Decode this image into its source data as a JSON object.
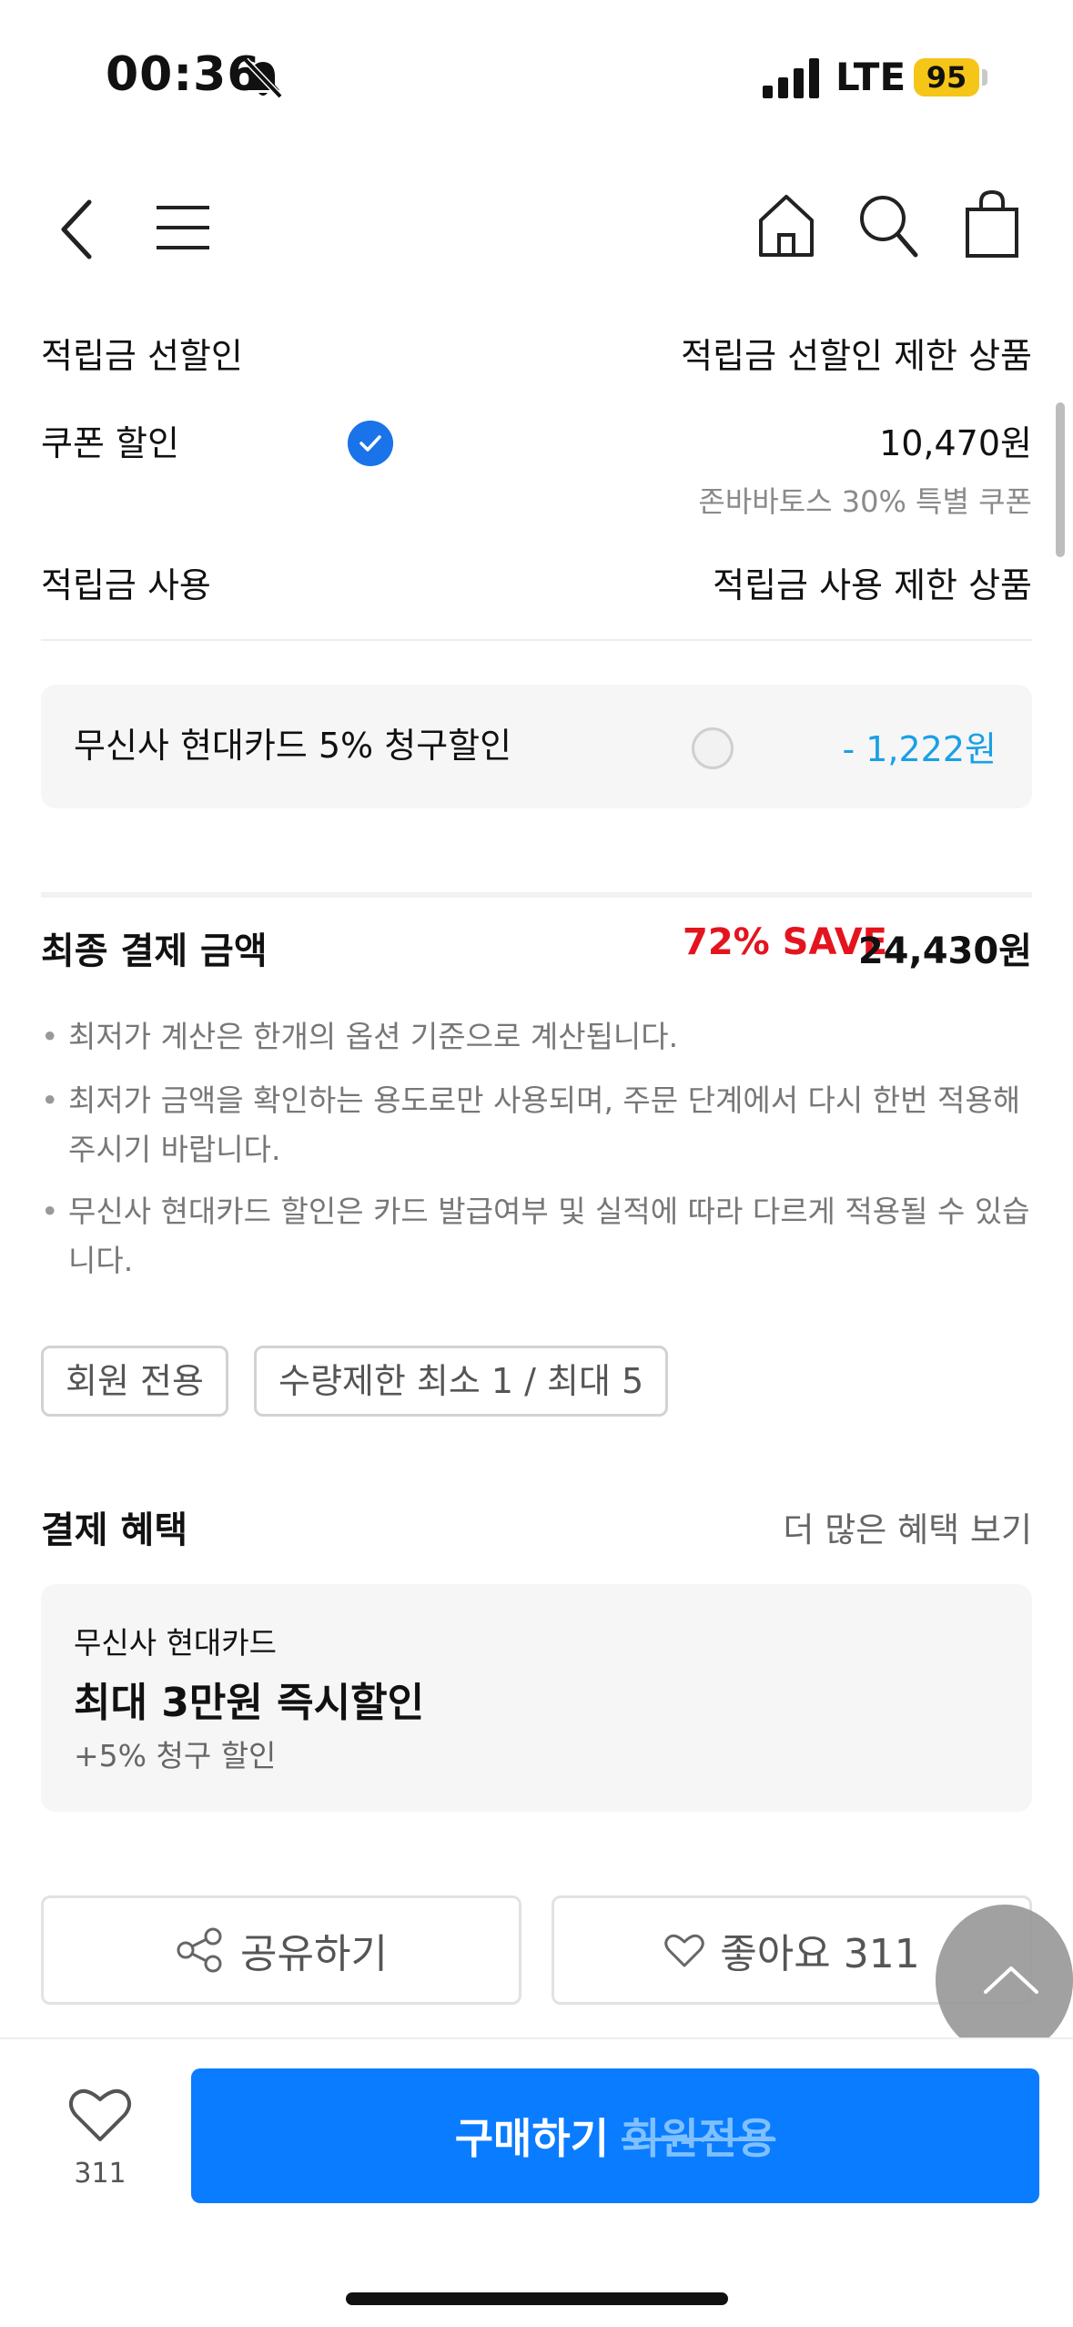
{
  "status_bar": {
    "time": "00:36",
    "network": "LTE",
    "battery": "95"
  },
  "colors": {
    "accent_blue": "#0a7cff",
    "save_red": "#e4141f",
    "discount_blue": "#1aa0e6",
    "battery_yellow": "#f5c518"
  },
  "nav": {
    "icons": [
      "back-icon",
      "menu-icon",
      "home-icon",
      "search-icon",
      "shopping-bag-icon"
    ]
  },
  "rows": {
    "points_pre_discount": {
      "label": "적립금 선할인",
      "value": "적립금 선할인 제한 상품"
    },
    "coupon_discount": {
      "label": "쿠폰 할인",
      "value": "10,470원",
      "sub": "존바바토스 30% 특별 쿠폰",
      "checked": true
    },
    "points_use": {
      "label": "적립금 사용",
      "value": "적립금 사용 제한 상품"
    }
  },
  "card_discount": {
    "label": "무신사 현대카드 5% 청구할인",
    "amount": "- 1,222원",
    "selected": false
  },
  "final": {
    "label": "최종 결제 금액",
    "save": "72% SAVE",
    "price": "24,430원"
  },
  "notes": [
    "최저가 계산은 한개의 옵션 기준으로 계산됩니다.",
    "최저가 금액을 확인하는 용도로만 사용되며, 주문 단계에서 다시 한번 적용해 주시기 바랍니다.",
    "무신사 현대카드 할인은 카드 발급여부 및 실적에 따라 다르게 적용될 수 있습니다."
  ],
  "tags": [
    "회원 전용",
    "수량제한 최소 1 / 최대 5"
  ],
  "benefits": {
    "title": "결제 혜택",
    "more": "더 많은 혜택 보기",
    "card": {
      "issuer": "무신사 현대카드",
      "main": "최대 3만원 즉시할인",
      "sub": "+5% 청구 할인"
    }
  },
  "actions": {
    "share": "공유하기",
    "like": "좋아요 311"
  },
  "bottom": {
    "like_count": "311",
    "buy_label": "구매하기",
    "buy_sub": "회원전용"
  }
}
